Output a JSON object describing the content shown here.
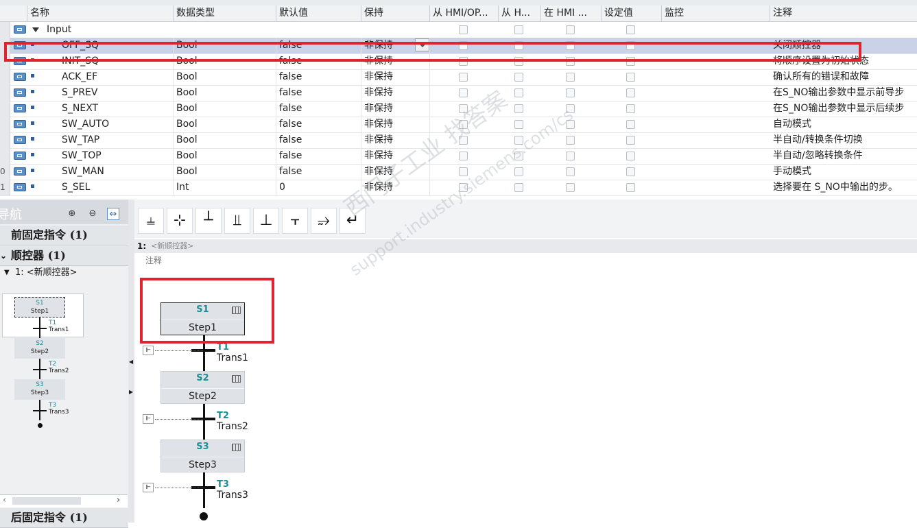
{
  "header": {
    "columns": [
      "名称",
      "数据类型",
      "默认值",
      "保持",
      "从 HMI/OP...",
      "从 H...",
      "在 HMI ...",
      "设定值",
      "监控",
      "注释"
    ]
  },
  "group": {
    "label": "Input"
  },
  "rows": [
    {
      "num": "",
      "name": "OFF_SQ",
      "type": "Bool",
      "default": "false",
      "retain": "非保持",
      "comment": "关闭顺控器"
    },
    {
      "num": "",
      "name": "INIT_SQ",
      "type": "Bool",
      "default": "false",
      "retain": "非保持",
      "comment": "将顺序设置为初始状态"
    },
    {
      "num": "",
      "name": "ACK_EF",
      "type": "Bool",
      "default": "false",
      "retain": "非保持",
      "comment": "确认所有的错误和故障"
    },
    {
      "num": "",
      "name": "S_PREV",
      "type": "Bool",
      "default": "false",
      "retain": "非保持",
      "comment": "在S_NO输出参数中显示前导步"
    },
    {
      "num": "",
      "name": "S_NEXT",
      "type": "Bool",
      "default": "false",
      "retain": "非保持",
      "comment": "在S_NO输出参数中显示后续步"
    },
    {
      "num": "",
      "name": "SW_AUTO",
      "type": "Bool",
      "default": "false",
      "retain": "非保持",
      "comment": "自动模式"
    },
    {
      "num": "",
      "name": "SW_TAP",
      "type": "Bool",
      "default": "false",
      "retain": "非保持",
      "comment": "半自动/转换条件切换"
    },
    {
      "num": "",
      "name": "SW_TOP",
      "type": "Bool",
      "default": "false",
      "retain": "非保持",
      "comment": "半自动/忽略转换条件"
    },
    {
      "num": "0",
      "name": "SW_MAN",
      "type": "Bool",
      "default": "false",
      "retain": "非保持",
      "comment": "手动模式"
    },
    {
      "num": "1",
      "name": "S_SEL",
      "type": "Int",
      "default": "0",
      "retain": "非保持",
      "comment": "选择要在 S_NO中输出的步。"
    }
  ],
  "nav": {
    "title": "导航",
    "sections": [
      {
        "label": "前固定指令 (1)"
      },
      {
        "label": "顺控器 (1)"
      }
    ],
    "sequence": "1: <新顺控器>",
    "footer": "后固定指令 (1)",
    "mini_steps": [
      {
        "num": "S1",
        "name": "Step1"
      },
      {
        "num": "S2",
        "name": "Step2"
      },
      {
        "num": "S3",
        "name": "Step3"
      }
    ],
    "mini_trans": [
      {
        "num": "T1",
        "name": "Trans1"
      },
      {
        "num": "T2",
        "name": "Trans2"
      },
      {
        "num": "T3",
        "name": "Trans3"
      }
    ]
  },
  "toolbar": {
    "icons": [
      "step-transition-icon",
      "step-icon",
      "transition-icon",
      "branch-icon",
      "sim-branch-icon",
      "alt-branch-icon",
      "jump-icon",
      "return-icon"
    ],
    "glyphs": [
      "⫨",
      "⊹",
      "┴",
      "⫫",
      "⊥",
      "⫟",
      "⥴",
      "↵"
    ]
  },
  "editor": {
    "network_num": "1:",
    "network_name": "<新顺控器>",
    "comment": "注释",
    "steps": [
      {
        "num": "S1",
        "name": "Step1"
      },
      {
        "num": "S2",
        "name": "Step2"
      },
      {
        "num": "S3",
        "name": "Step3"
      }
    ],
    "transitions": [
      {
        "num": "T1",
        "name": "Trans1"
      },
      {
        "num": "T2",
        "name": "Trans2"
      },
      {
        "num": "T3",
        "name": "Trans3"
      }
    ]
  },
  "watermark": {
    "line1": "西门子工业  找答案",
    "line2": "support.industry.siemens.com/cs"
  },
  "colors": {
    "accent": "#1b8e95",
    "highlight": "#e0242e",
    "selection": "#c9d2e6"
  }
}
